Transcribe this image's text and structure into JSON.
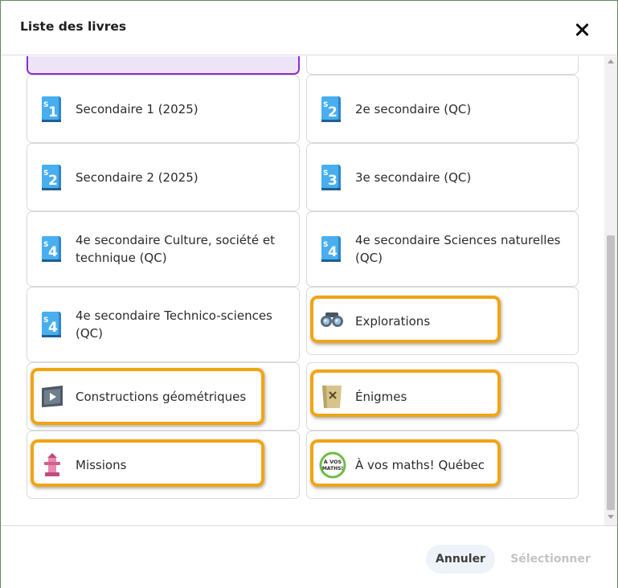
{
  "dialog": {
    "title": "Liste des livres",
    "close_icon": "close-x-icon"
  },
  "books": [
    {
      "label": "Secondaire 1 (2025)",
      "icon": "book-s1-icon",
      "badge": "1"
    },
    {
      "label": "2e secondaire (QC)",
      "icon": "book-s2-icon",
      "badge": "2"
    },
    {
      "label": "Secondaire 2 (2025)",
      "icon": "book-s2-icon",
      "badge": "2"
    },
    {
      "label": "3e secondaire (QC)",
      "icon": "book-s3-icon",
      "badge": "3"
    },
    {
      "label": "4e secondaire Culture, société et technique (QC)",
      "icon": "book-s4-icon",
      "badge": "4"
    },
    {
      "label": "4e secondaire Sciences naturelles (QC)",
      "icon": "book-s4-icon",
      "badge": "4"
    },
    {
      "label": "4e secondaire Technico-sciences (QC)",
      "icon": "book-s4-icon",
      "badge": "4"
    },
    {
      "label": "Explorations",
      "icon": "binoculars-icon"
    },
    {
      "label": "Constructions géométriques",
      "icon": "video-board-icon"
    },
    {
      "label": "Énigmes",
      "icon": "treasure-map-icon"
    },
    {
      "label": "Missions",
      "icon": "tower-icon"
    },
    {
      "label": "À vos maths! Québec",
      "icon": "a-vos-maths-logo-icon"
    }
  ],
  "icon_badge_letter": "S",
  "avosmaths_logo_text": [
    "À VOS",
    "MATHS!"
  ],
  "footer": {
    "cancel_label": "Annuler",
    "select_label": "Sélectionner"
  },
  "colors": {
    "book_blue": "#3a9be0",
    "selected_bg": "#eee4f7",
    "selected_border": "#8a2fc9",
    "highlight": "#f2a413"
  }
}
